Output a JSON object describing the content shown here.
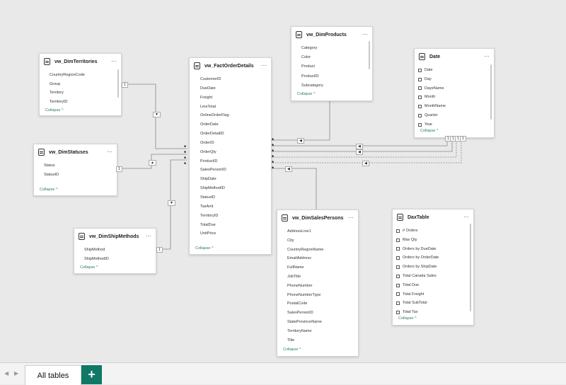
{
  "tables": {
    "territories": {
      "title": "vw_DimTerritories",
      "fields": [
        "CountryRegionCode",
        "Group",
        "Territory",
        "TerritoryID"
      ],
      "collapse": "Collapse"
    },
    "fact": {
      "title": "vw_FactOrderDetails",
      "fields": [
        "CustomerID",
        "DueDate",
        "Freight",
        "LineTotal",
        "OnlineOrderFlag",
        "OrderDate",
        "OrderDetailID",
        "OrderID",
        "OrderQty",
        "ProductID",
        "SalesPersonID",
        "ShipDate",
        "ShipMethodID",
        "StatusID",
        "TaxAmt",
        "TerritoryID",
        "TotalDue",
        "UnitPrice"
      ],
      "collapse": "Collapse"
    },
    "products": {
      "title": "vw_DimProducts",
      "fields": [
        "Category",
        "Color",
        "Product",
        "ProductID",
        "Subcategory"
      ],
      "collapse": "Collapse"
    },
    "date": {
      "title": "Date",
      "fields": [
        "Date",
        "Day",
        "DayeName",
        "Month",
        "MonthName",
        "Quarter",
        "Year"
      ],
      "collapse": "Collapse"
    },
    "statuses": {
      "title": "vw_DimStatuses",
      "fields": [
        "Status",
        "StatusID"
      ],
      "collapse": "Collapse"
    },
    "shipmethods": {
      "title": "vw_DimShipMethods",
      "fields": [
        "ShipMethod",
        "ShipMethodID"
      ],
      "collapse": "Collapse"
    },
    "salespersons": {
      "title": "vw_DimSalesPersons",
      "fields": [
        "AddressLine1",
        "City",
        "CountryRegionName",
        "EmailAddress",
        "FullName",
        "JobTitle",
        "PhoneNumber",
        "PhoneNumberType",
        "PostalCode",
        "SalesPersonID",
        "StateProvinceName",
        "TerritoryName",
        "Title"
      ],
      "collapse": "Collapse"
    },
    "dax": {
      "title": "DaxTable",
      "fields": [
        "# Orders",
        "Max Qty",
        "Orders by DueDate",
        "Orders by OrderDate",
        "Orders by ShipDate",
        "Total Canada Sales",
        "Total Due",
        "Total Freight",
        "Total SubTotal",
        "Total Tax"
      ],
      "collapse": "Collapse"
    }
  },
  "more_label": "···",
  "cardinality": {
    "one": "1",
    "many": "*"
  },
  "tabbar": {
    "tab_label": "All tables",
    "add_label": "+"
  }
}
